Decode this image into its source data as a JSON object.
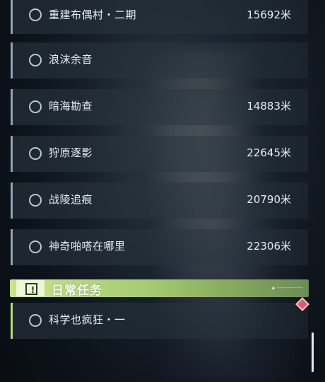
{
  "quests": [
    {
      "name": "重建布偶村・二期",
      "distance": "15692米"
    },
    {
      "name": "浪沫余音",
      "distance": ""
    },
    {
      "name": "暗海勘查",
      "distance": "14883米"
    },
    {
      "name": "狩原逐影",
      "distance": "22645米"
    },
    {
      "name": "战陵追痕",
      "distance": "20790米"
    },
    {
      "name": "神奇啪嗒在哪里",
      "distance": "22306米"
    }
  ],
  "daily": {
    "title": "日常任务",
    "badge_symbol": "!",
    "items": [
      {
        "name": "科学也疯狂・一",
        "distance": ""
      }
    ]
  },
  "colors": {
    "daily_accent": "#b7d97e",
    "main_accent": "#8ea2b0",
    "marker": "#e05a6a"
  },
  "icons": {
    "quest_status": "circle-outline-icon",
    "daily_badge": "exclamation-box-icon",
    "tracking_marker": "diamond-marker-icon"
  }
}
